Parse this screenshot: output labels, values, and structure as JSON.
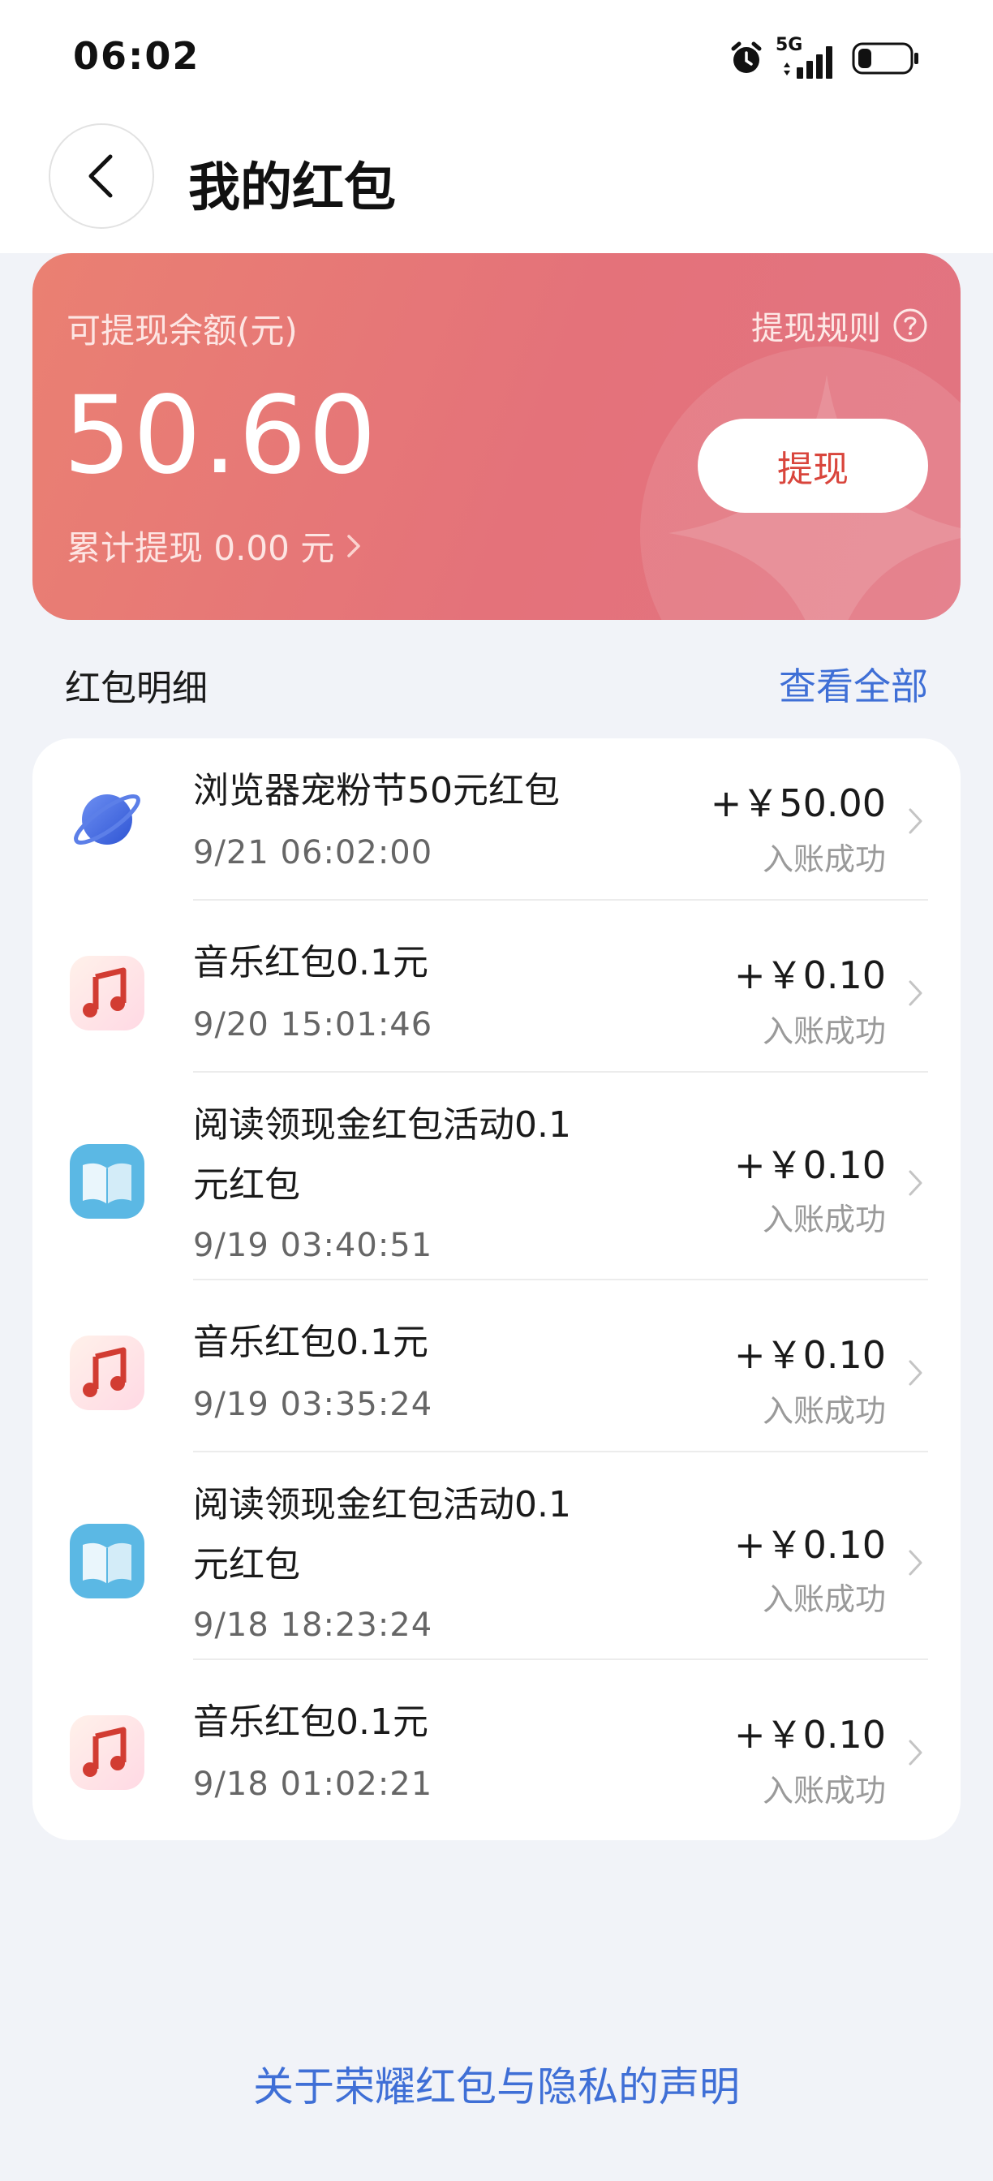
{
  "status_bar": {
    "time": "06:02",
    "network": "5G"
  },
  "header": {
    "title": "我的红包"
  },
  "balance_card": {
    "label": "可提现余额(元)",
    "rule_label": "提现规则",
    "amount": "50.60",
    "withdraw_label": "提现",
    "total_withdrawn": "累计提现 0.00 元"
  },
  "details": {
    "title": "红包明细",
    "view_all": "查看全部",
    "items": [
      {
        "icon": "browser-icon",
        "title_line1": "浏览器宠粉节50元红包",
        "title_line2": "",
        "time": "9/21 06:02:00",
        "amount": "+￥50.00",
        "status": "入账成功"
      },
      {
        "icon": "music-icon",
        "title_line1": "音乐红包0.1元",
        "title_line2": "",
        "time": "9/20 15:01:46",
        "amount": "+￥0.10",
        "status": "入账成功"
      },
      {
        "icon": "reading-icon",
        "title_line1": "阅读领现金红包活动0.1",
        "title_line2": "元红包",
        "time": "9/19 03:40:51",
        "amount": "+￥0.10",
        "status": "入账成功"
      },
      {
        "icon": "music-icon",
        "title_line1": "音乐红包0.1元",
        "title_line2": "",
        "time": "9/19 03:35:24",
        "amount": "+￥0.10",
        "status": "入账成功"
      },
      {
        "icon": "reading-icon",
        "title_line1": "阅读领现金红包活动0.1",
        "title_line2": "元红包",
        "time": "9/18 18:23:24",
        "amount": "+￥0.10",
        "status": "入账成功"
      },
      {
        "icon": "music-icon",
        "title_line1": "音乐红包0.1元",
        "title_line2": "",
        "time": "9/18 01:02:21",
        "amount": "+￥0.10",
        "status": "入账成功"
      }
    ]
  },
  "footer": {
    "privacy_link": "关于荣耀红包与隐私的声明"
  },
  "colors": {
    "accent_blue": "#3f6fd6",
    "card_red": "#e4727a",
    "button_text_red": "#d9453c"
  }
}
